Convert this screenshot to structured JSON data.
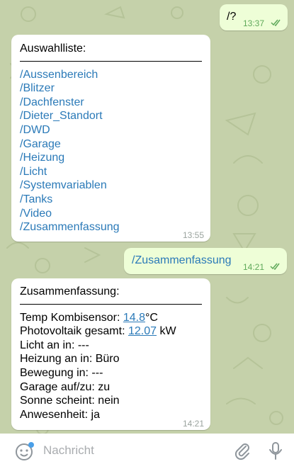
{
  "messages": {
    "out1": {
      "text": "/?",
      "time": "13:37"
    },
    "in1": {
      "title": "Auswahlliste:",
      "commands": [
        "/Aussenbereich",
        "/Blitzer",
        "/Dachfenster",
        "/Dieter_Standort",
        "/DWD",
        "/Garage",
        "/Heizung",
        "/Licht",
        "/Systemvariablen",
        "/Tanks",
        "/Video",
        "/Zusammenfassung"
      ],
      "time": "13:55"
    },
    "out2": {
      "text": "/Zusammenfassung",
      "time": "14:21"
    },
    "in2": {
      "title": "Zusammenfassung:",
      "temp_label": "Temp Kombisensor: ",
      "temp_value": "14.8",
      "temp_unit": "°C",
      "pv_label": "Photovoltaik gesamt: ",
      "pv_value": "12.07",
      "pv_unit": " kW",
      "lines": [
        "Licht an in: ---",
        "Heizung an in: Büro",
        "Bewegung in: ---",
        "Garage auf/zu: zu",
        "Sonne scheint: nein",
        "Anwesenheit: ja"
      ],
      "time": "14:21"
    }
  },
  "input": {
    "placeholder": "Nachricht"
  },
  "colors": {
    "link": "#2b7ab8",
    "outgoing_bubble": "#eefed7",
    "check": "#5fa95a"
  },
  "icons": [
    "emoji-icon",
    "attach-icon",
    "mic-icon",
    "double-check-icon"
  ]
}
